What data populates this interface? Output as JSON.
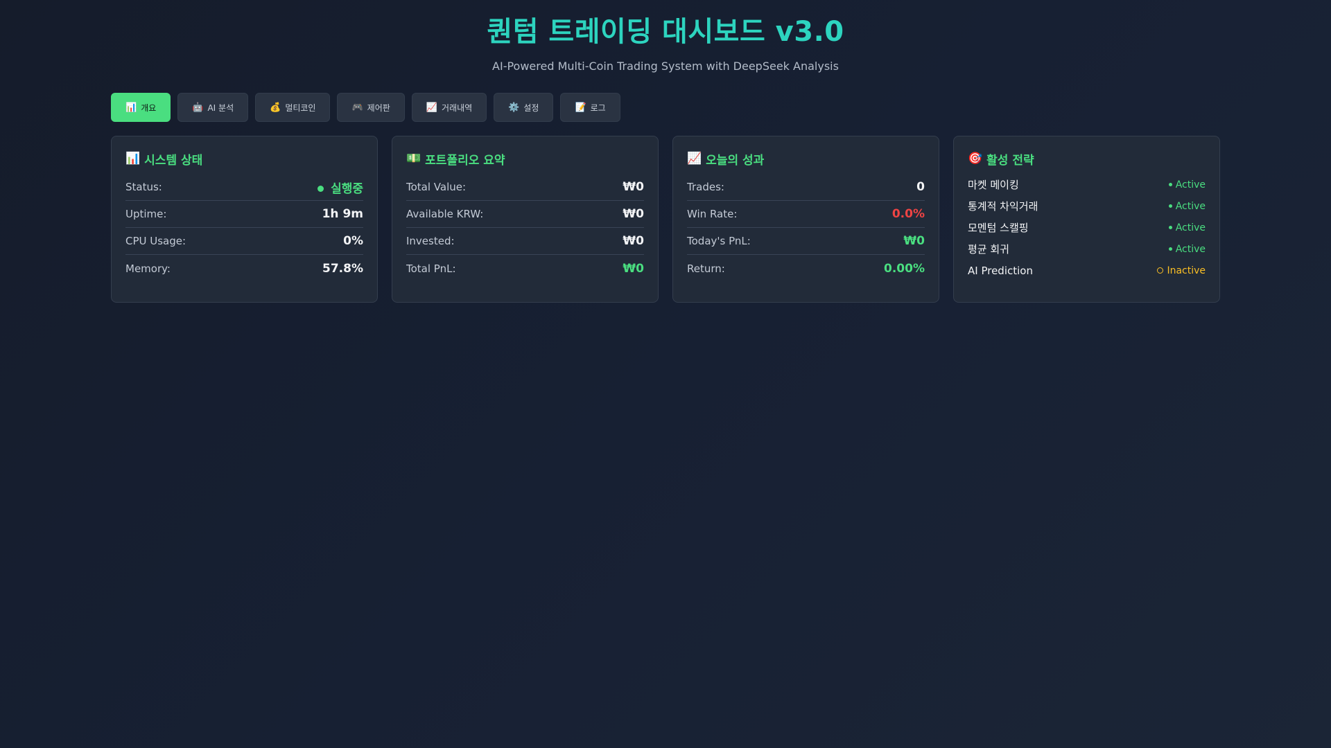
{
  "header": {
    "title": "퀀텀 트레이딩 대시보드 v3.0",
    "subtitle": "AI-Powered Multi-Coin Trading System with DeepSeek Analysis"
  },
  "tabs": [
    {
      "icon": "📊",
      "label": "개요",
      "active": true
    },
    {
      "icon": "🤖",
      "label": "AI 분석"
    },
    {
      "icon": "💰",
      "label": "멀티코인"
    },
    {
      "icon": "🎮",
      "label": "제어판"
    },
    {
      "icon": "📈",
      "label": "거래내역"
    },
    {
      "icon": "⚙️",
      "label": "설정"
    },
    {
      "icon": "📝",
      "label": "로그"
    }
  ],
  "system": {
    "icon": "📊",
    "title": "시스템 상태",
    "rows": [
      {
        "label": "Status:",
        "value": "실행중"
      },
      {
        "label": "Uptime:",
        "value": "1h 9m"
      },
      {
        "label": "CPU Usage:",
        "value": "0%"
      },
      {
        "label": "Memory:",
        "value": "57.8%"
      }
    ]
  },
  "portfolio": {
    "icon": "💵",
    "title": "포트폴리오 요약",
    "rows": [
      {
        "label": "Total Value:",
        "value": "₩0"
      },
      {
        "label": "Available KRW:",
        "value": "₩0"
      },
      {
        "label": "Invested:",
        "value": "₩0"
      },
      {
        "label": "Total PnL:",
        "value": "₩0"
      }
    ]
  },
  "performance": {
    "icon": "📈",
    "title": "오늘의 성과",
    "rows": [
      {
        "label": "Trades:",
        "value": "0"
      },
      {
        "label": "Win Rate:",
        "value": "0.0%"
      },
      {
        "label": "Today's PnL:",
        "value": "₩0"
      },
      {
        "label": "Return:",
        "value": "0.00%"
      }
    ]
  },
  "strategies": {
    "icon": "🎯",
    "title": "활성 전략",
    "items": [
      {
        "name": "마켓 메이킹",
        "state": "Active"
      },
      {
        "name": "통계적 차익거래",
        "state": "Active"
      },
      {
        "name": "모멘텀 스캘핑",
        "state": "Active"
      },
      {
        "name": "평균 회귀",
        "state": "Active"
      },
      {
        "name": "AI Prediction",
        "state": "Inactive"
      }
    ]
  },
  "colors": {
    "accent": "#4ade80",
    "title": "#2dd4bf",
    "negative": "#ef4444",
    "inactive": "#fbbf24",
    "background": "#172033",
    "card": "#222b39"
  }
}
